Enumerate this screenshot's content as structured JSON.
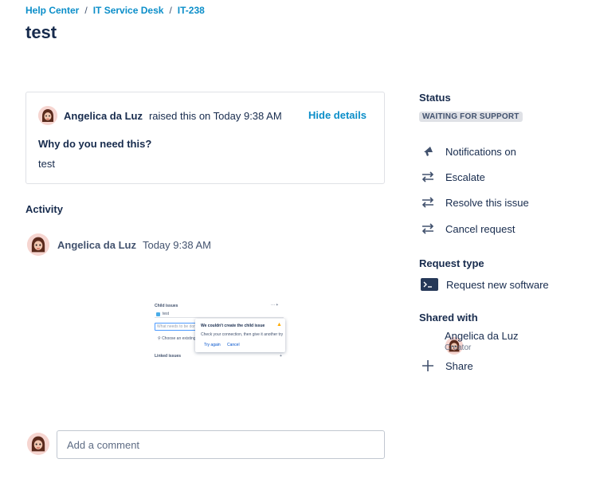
{
  "breadcrumbs": [
    "Help Center",
    "IT Service Desk",
    "IT-238"
  ],
  "title": "test",
  "request": {
    "reporter": "Angelica da Luz",
    "raised_text": "raised this on Today 9:38 AM",
    "hide_details": "Hide details",
    "question": "Why do you need this?",
    "answer": "test"
  },
  "activity": {
    "heading": "Activity",
    "author": "Angelica da Luz",
    "time": "Today 9:38 AM",
    "attachment": {
      "child_issues": "Child issues",
      "item": "test",
      "placeholder": "What needs to be done?",
      "choose": "Choose an existing",
      "error_title": "We couldn't create the child issue",
      "error_body": "Check your connection, then give it another try",
      "try_again": "Try again",
      "cancel": "Cancel",
      "linked_issues": "Linked issues"
    }
  },
  "comment": {
    "placeholder": "Add a comment"
  },
  "sidebar": {
    "status_heading": "Status",
    "status_value": "WAITING FOR SUPPORT",
    "actions": [
      {
        "label": "Notifications on",
        "icon": "megaphone-icon"
      },
      {
        "label": "Escalate",
        "icon": "transition-icon"
      },
      {
        "label": "Resolve this issue",
        "icon": "transition-icon"
      },
      {
        "label": "Cancel request",
        "icon": "transition-icon"
      }
    ],
    "request_type_heading": "Request type",
    "request_type": "Request new software",
    "shared_with_heading": "Shared with",
    "shared_name": "Angelica da Luz",
    "shared_role": "Creator",
    "share_label": "Share"
  },
  "colors": {
    "link": "#0b8ec9",
    "text": "#172b4d",
    "badge_bg": "#dfe1e6"
  }
}
